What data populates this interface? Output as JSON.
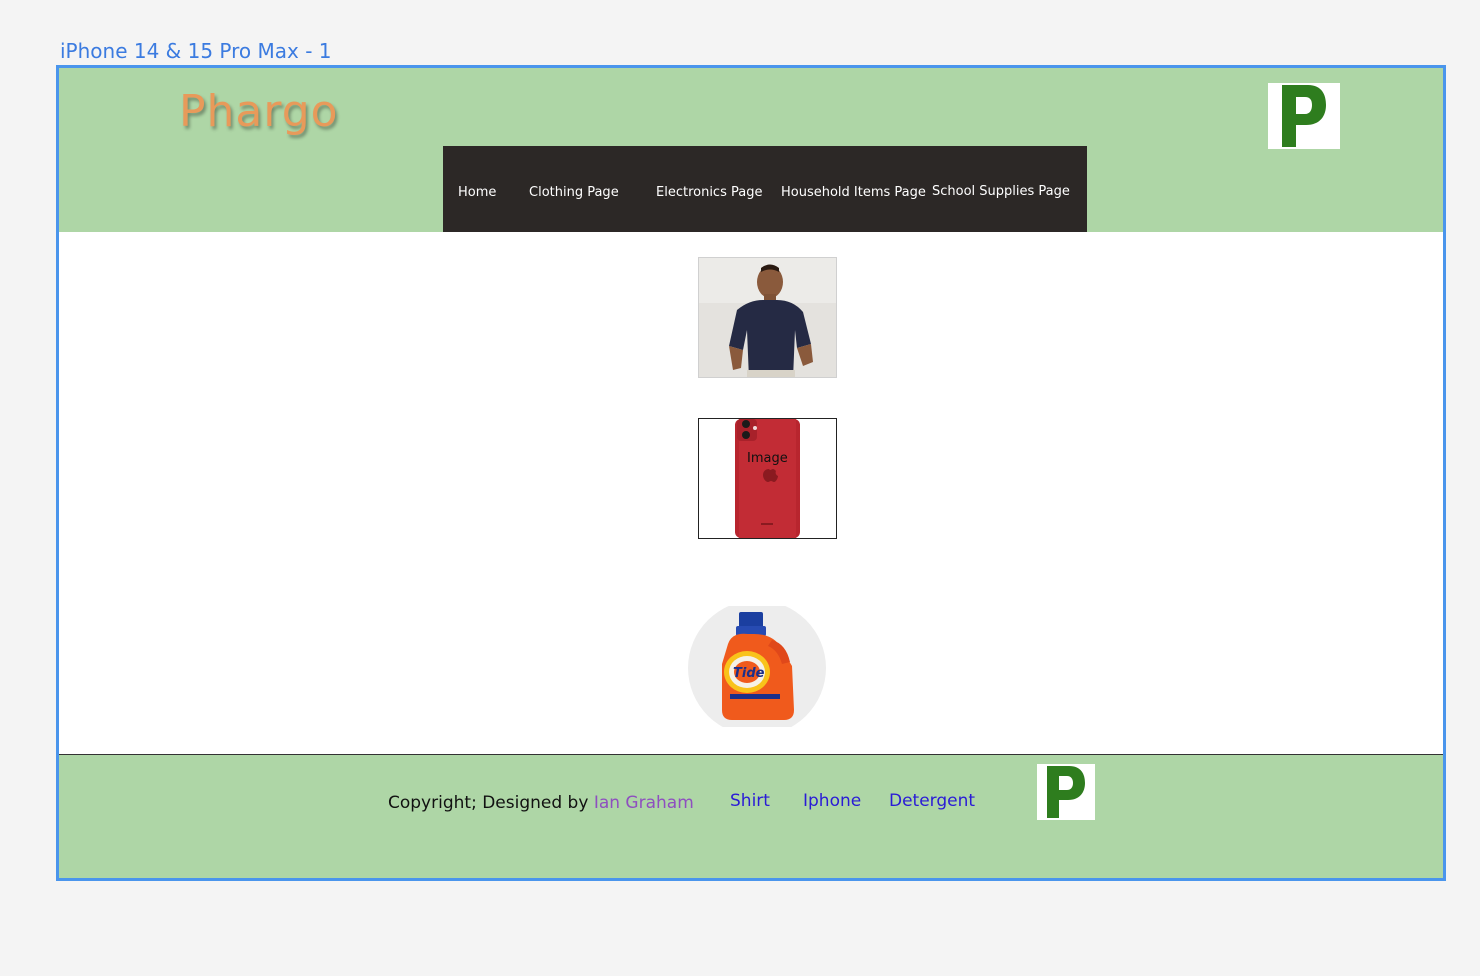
{
  "frame": {
    "title": "iPhone 14 & 15 Pro Max - 1"
  },
  "header": {
    "brand": "Phargo",
    "logo_letter": "P",
    "nav": [
      "Home",
      "Clothing Page",
      "Electronics Page",
      "Household Items Page",
      "School Supplies Page"
    ]
  },
  "products": {
    "phone_image_label": "Image"
  },
  "footer": {
    "copyright_prefix": "Copyright; Designed by ",
    "author": "Ian Graham",
    "links": [
      "Shirt",
      "Iphone",
      "Detergent"
    ],
    "logo_letter": "P"
  },
  "colors": {
    "header_bg": "#aed6a6",
    "nav_bg": "#2c2826",
    "brand": "#e89a5a",
    "logo_green": "#2e7d1e",
    "link": "#2a1bd6",
    "author": "#8e4fbf",
    "frame_border": "#4a95ec"
  }
}
